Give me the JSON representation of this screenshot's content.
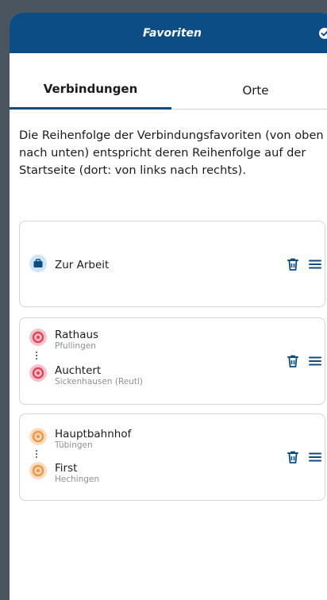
{
  "header": {
    "title": "Favoriten"
  },
  "tabs": [
    {
      "label": "Verbindungen"
    },
    {
      "label": "Orte"
    }
  ],
  "description": "Die Reihenfolge der Verbindungsfavoriten (von oben nach unten) entspricht deren Reihenfolge auf der Startseite (dort: von links nach rechts).",
  "favorites": [
    {
      "label": "Zur Arbeit",
      "icon": "briefcase-icon"
    },
    {
      "from": {
        "name": "Rathaus",
        "place": "Pfullingen"
      },
      "to": {
        "name": "Auchtert",
        "place": "Sickenhausen (Reutl)"
      },
      "color": "#e0455a"
    },
    {
      "from": {
        "name": "Hauptbahnhof",
        "place": "Tübingen"
      },
      "to": {
        "name": "First",
        "place": "Hechingen"
      },
      "color": "#f0963e"
    }
  ],
  "colors": {
    "brand": "#0b4d84",
    "accent_blue": "#2f8fd8"
  }
}
